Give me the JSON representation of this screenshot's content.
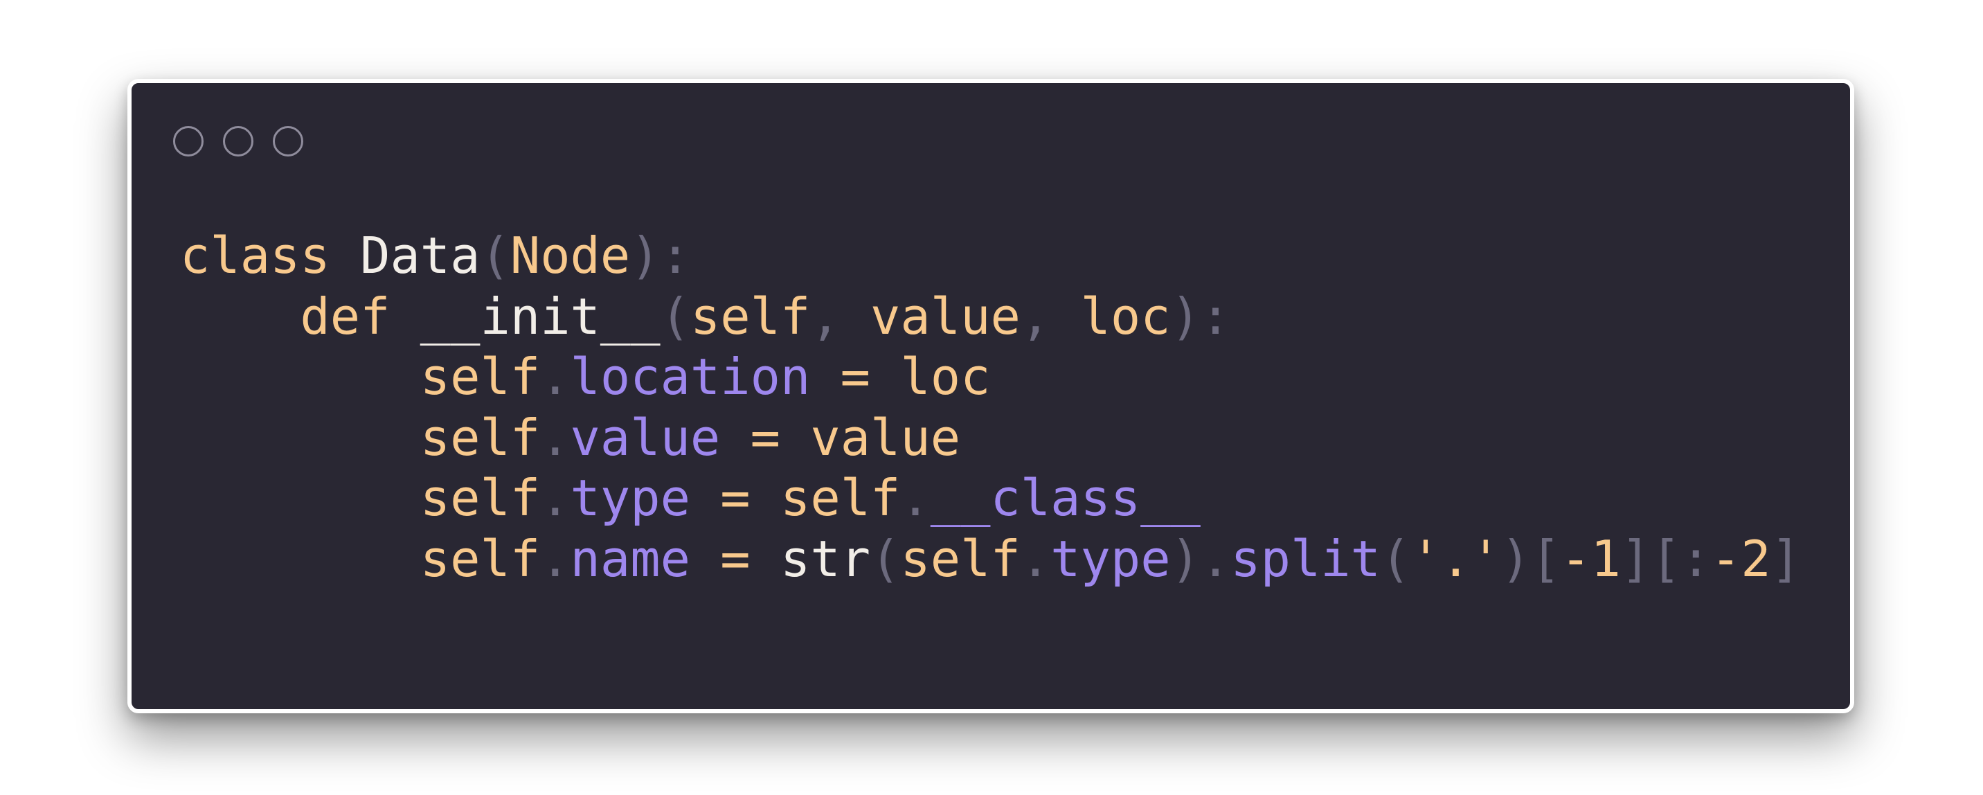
{
  "window": {
    "controls": [
      "close",
      "minimize",
      "maximize"
    ]
  },
  "colors": {
    "background": "#292733",
    "keyword": "#f8c98d",
    "identifier": "#f2eee8",
    "attribute": "#9e87ee",
    "punctuation": "#6c6a7e"
  },
  "code": {
    "language": "python",
    "lines": [
      [
        {
          "t": "class",
          "k": "kw"
        },
        {
          "t": " ",
          "k": "sp"
        },
        {
          "t": "Data",
          "k": "cls"
        },
        {
          "t": "(",
          "k": "punc"
        },
        {
          "t": "Node",
          "k": "kw"
        },
        {
          "t": "):",
          "k": "punc"
        }
      ],
      [
        {
          "t": "    ",
          "k": "sp"
        },
        {
          "t": "def",
          "k": "kw"
        },
        {
          "t": " ",
          "k": "sp"
        },
        {
          "t": "__init__",
          "k": "cls"
        },
        {
          "t": "(",
          "k": "punc"
        },
        {
          "t": "self",
          "k": "kw"
        },
        {
          "t": ",",
          "k": "punc"
        },
        {
          "t": " ",
          "k": "sp"
        },
        {
          "t": "value",
          "k": "kw"
        },
        {
          "t": ",",
          "k": "punc"
        },
        {
          "t": " ",
          "k": "sp"
        },
        {
          "t": "loc",
          "k": "kw"
        },
        {
          "t": "):",
          "k": "punc"
        }
      ],
      [
        {
          "t": "        ",
          "k": "sp"
        },
        {
          "t": "self",
          "k": "kw"
        },
        {
          "t": ".",
          "k": "punc"
        },
        {
          "t": "location",
          "k": "attr"
        },
        {
          "t": " ",
          "k": "sp"
        },
        {
          "t": "=",
          "k": "op"
        },
        {
          "t": " ",
          "k": "sp"
        },
        {
          "t": "loc",
          "k": "kw"
        }
      ],
      [
        {
          "t": "        ",
          "k": "sp"
        },
        {
          "t": "self",
          "k": "kw"
        },
        {
          "t": ".",
          "k": "punc"
        },
        {
          "t": "value",
          "k": "attr"
        },
        {
          "t": " ",
          "k": "sp"
        },
        {
          "t": "=",
          "k": "op"
        },
        {
          "t": " ",
          "k": "sp"
        },
        {
          "t": "value",
          "k": "kw"
        }
      ],
      [
        {
          "t": "        ",
          "k": "sp"
        },
        {
          "t": "self",
          "k": "kw"
        },
        {
          "t": ".",
          "k": "punc"
        },
        {
          "t": "type",
          "k": "attr"
        },
        {
          "t": " ",
          "k": "sp"
        },
        {
          "t": "=",
          "k": "op"
        },
        {
          "t": " ",
          "k": "sp"
        },
        {
          "t": "self",
          "k": "kw"
        },
        {
          "t": ".",
          "k": "punc"
        },
        {
          "t": "__class__",
          "k": "attr"
        }
      ],
      [
        {
          "t": "        ",
          "k": "sp"
        },
        {
          "t": "self",
          "k": "kw"
        },
        {
          "t": ".",
          "k": "punc"
        },
        {
          "t": "name",
          "k": "attr"
        },
        {
          "t": " ",
          "k": "sp"
        },
        {
          "t": "=",
          "k": "op"
        },
        {
          "t": " ",
          "k": "sp"
        },
        {
          "t": "str",
          "k": "cls"
        },
        {
          "t": "(",
          "k": "punc"
        },
        {
          "t": "self",
          "k": "kw"
        },
        {
          "t": ".",
          "k": "punc"
        },
        {
          "t": "type",
          "k": "attr"
        },
        {
          "t": ")",
          "k": "punc"
        },
        {
          "t": ".",
          "k": "punc"
        },
        {
          "t": "split",
          "k": "attr"
        },
        {
          "t": "(",
          "k": "punc"
        },
        {
          "t": "'.'",
          "k": "str"
        },
        {
          "t": ")",
          "k": "punc"
        },
        {
          "t": "[",
          "k": "punc"
        },
        {
          "t": "-1",
          "k": "num"
        },
        {
          "t": "]",
          "k": "punc"
        },
        {
          "t": "[",
          "k": "punc"
        },
        {
          "t": ":",
          "k": "punc"
        },
        {
          "t": "-2",
          "k": "num"
        },
        {
          "t": "]",
          "k": "punc"
        }
      ]
    ]
  }
}
